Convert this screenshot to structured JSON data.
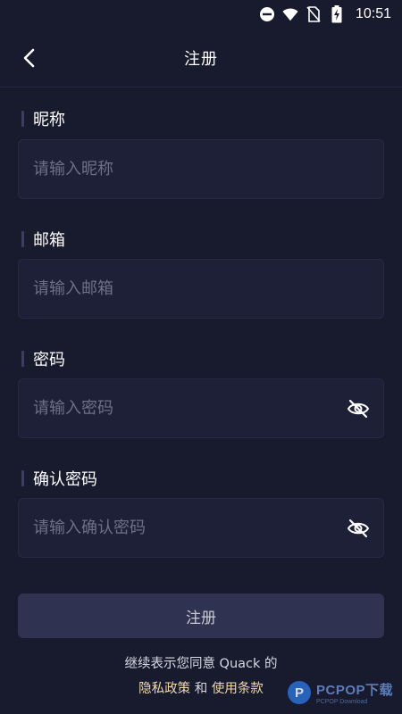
{
  "status_bar": {
    "time": "10:51",
    "icons": [
      "do-not-disturb-icon",
      "wifi-icon",
      "no-sim-icon",
      "battery-charging-icon"
    ]
  },
  "header": {
    "back_icon": "chevron-left-icon",
    "title": "注册"
  },
  "form": {
    "nickname": {
      "label": "昵称",
      "placeholder": "请输入昵称"
    },
    "email": {
      "label": "邮箱",
      "placeholder": "请输入邮箱"
    },
    "password": {
      "label": "密码",
      "placeholder": "请输入密码",
      "toggle_icon": "eye-off-icon"
    },
    "confirm_password": {
      "label": "确认密码",
      "placeholder": "请输入确认密码",
      "toggle_icon": "eye-off-icon"
    }
  },
  "submit_label": "注册",
  "agreement": {
    "line1": "继续表示您同意 Quack 的",
    "privacy_link": "隐私政策",
    "and": "和",
    "terms_link": "使用条款"
  },
  "watermark": {
    "brand": "PCPOP下载",
    "sub": "PCPOP Download"
  },
  "colors": {
    "background": "#181a2e",
    "input_background": "#1d2036",
    "button_background": "#2f3250",
    "link": "#f1d9a8",
    "placeholder": "#6d7089"
  }
}
